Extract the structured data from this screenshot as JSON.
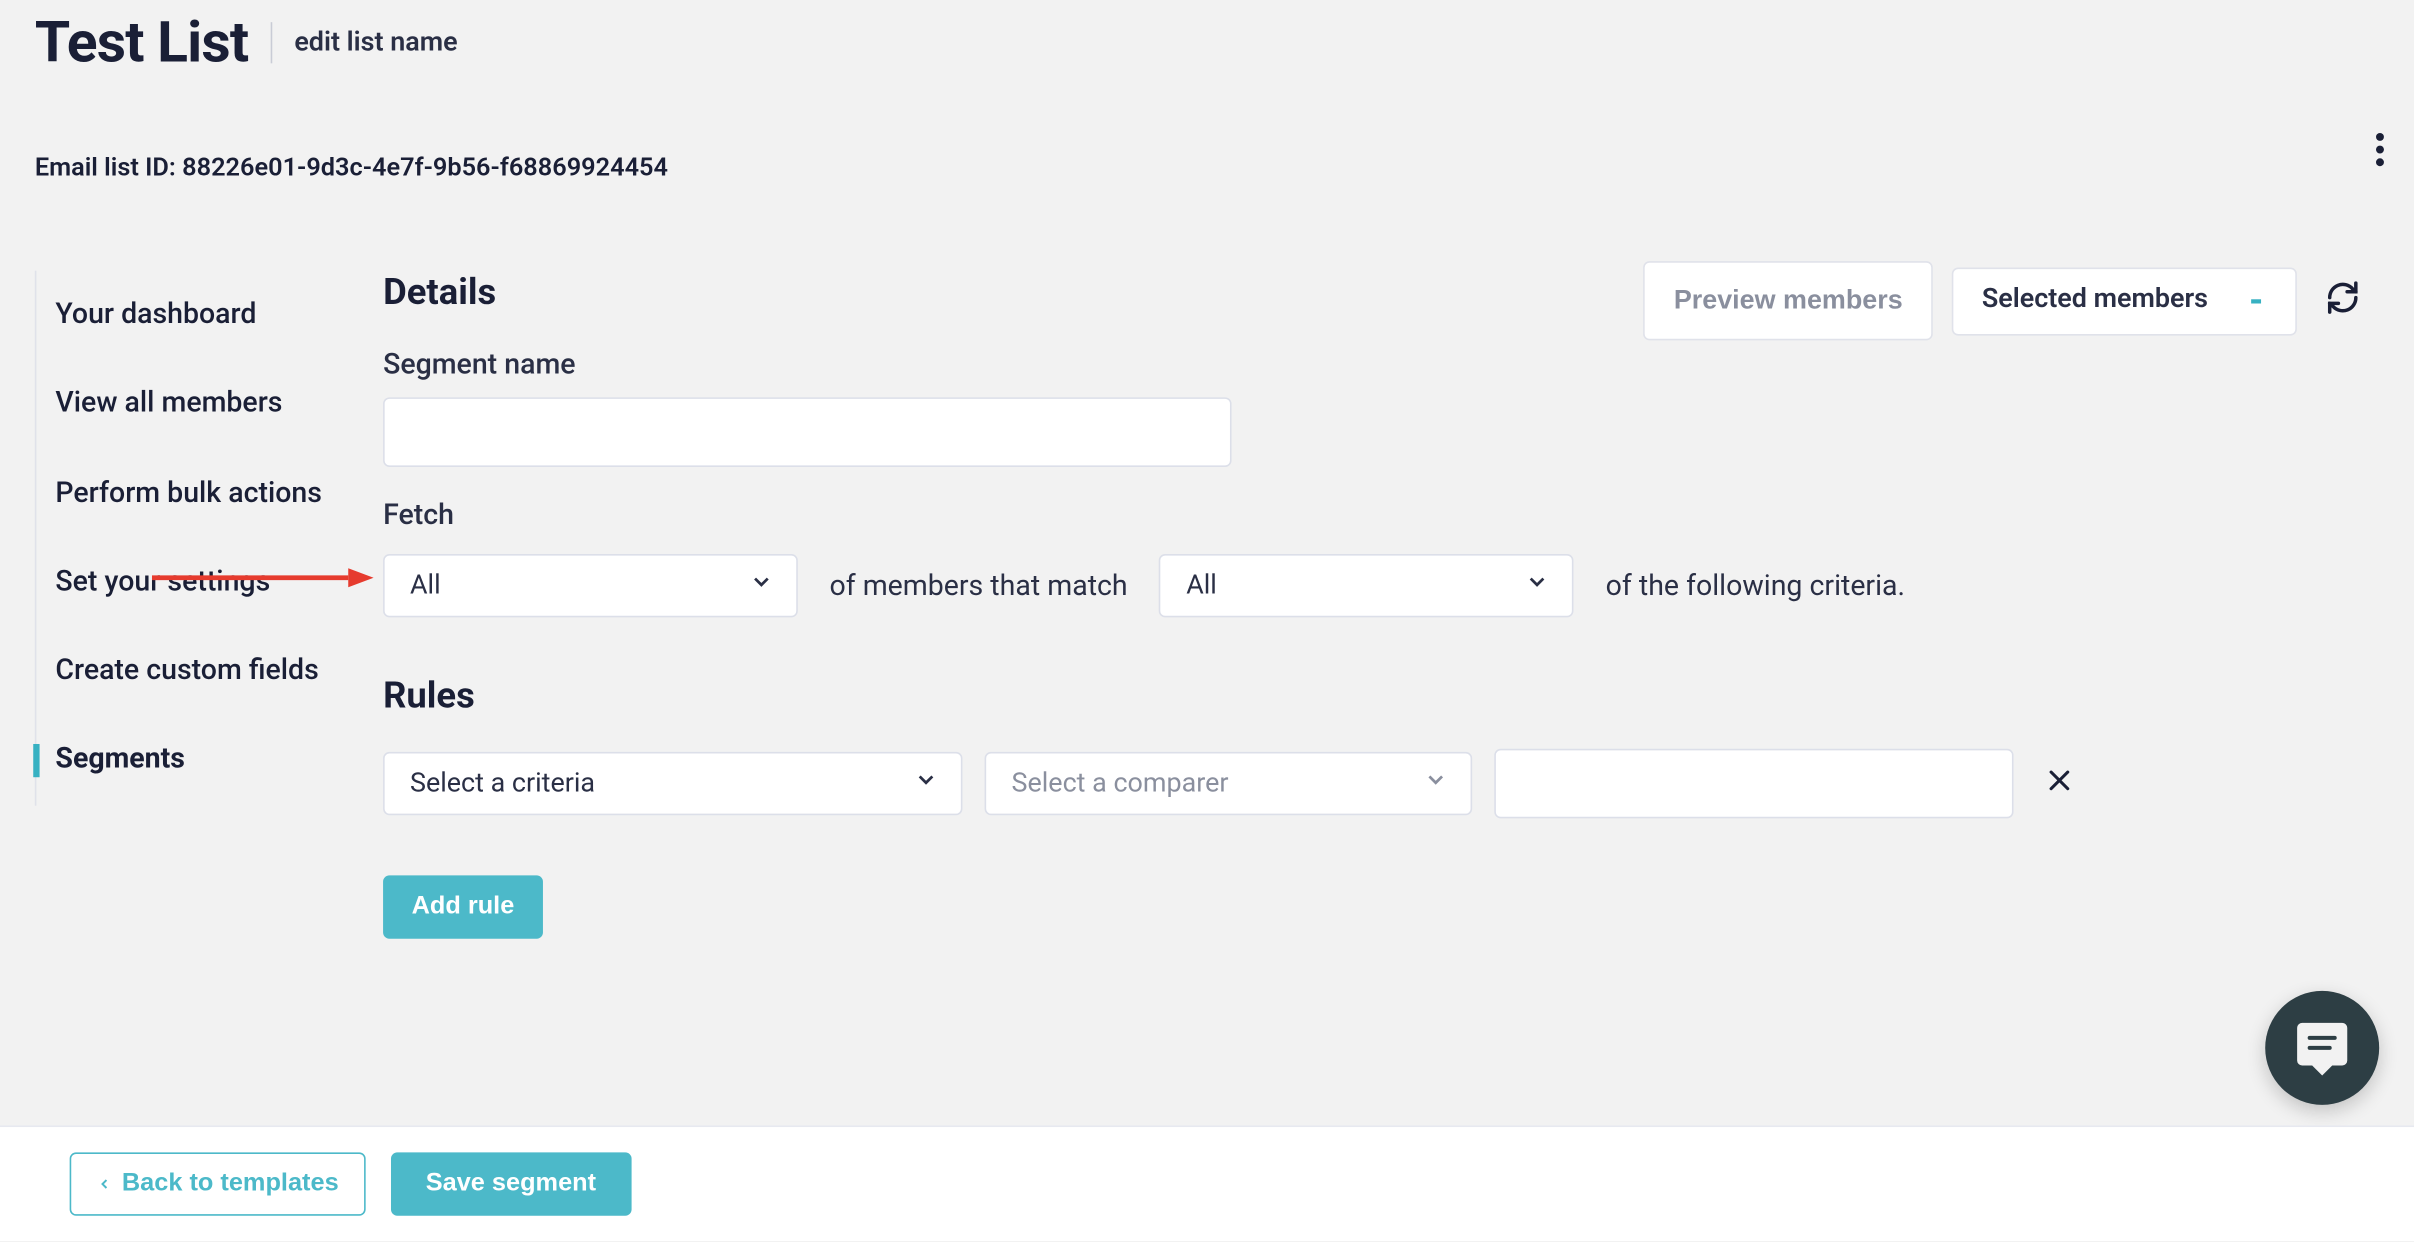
{
  "header": {
    "title": "Test List",
    "edit_link": "edit list name",
    "list_id_label": "Email list ID: 88226e01-9d3c-4e7f-9b56-f68869924454"
  },
  "sidebar": {
    "items": [
      {
        "label": "Your dashboard"
      },
      {
        "label": "View all members"
      },
      {
        "label": "Perform bulk actions"
      },
      {
        "label": "Set your settings"
      },
      {
        "label": "Create custom fields"
      },
      {
        "label": "Segments"
      }
    ]
  },
  "top_actions": {
    "preview_label": "Preview members",
    "selected_label": "Selected members",
    "selected_count": "-"
  },
  "details": {
    "heading": "Details",
    "segment_name_label": "Segment name",
    "segment_name_value": "",
    "fetch_label": "Fetch",
    "scope_select": "All",
    "match_text_1": "of members that match",
    "criteria_select": "All",
    "match_text_2": "of the following criteria."
  },
  "rules": {
    "heading": "Rules",
    "criteria_placeholder": "Select a criteria",
    "comparer_placeholder": "Select a comparer",
    "value": "",
    "add_rule_label": "Add rule"
  },
  "footer": {
    "back_label": "Back to templates",
    "save_label": "Save segment"
  }
}
